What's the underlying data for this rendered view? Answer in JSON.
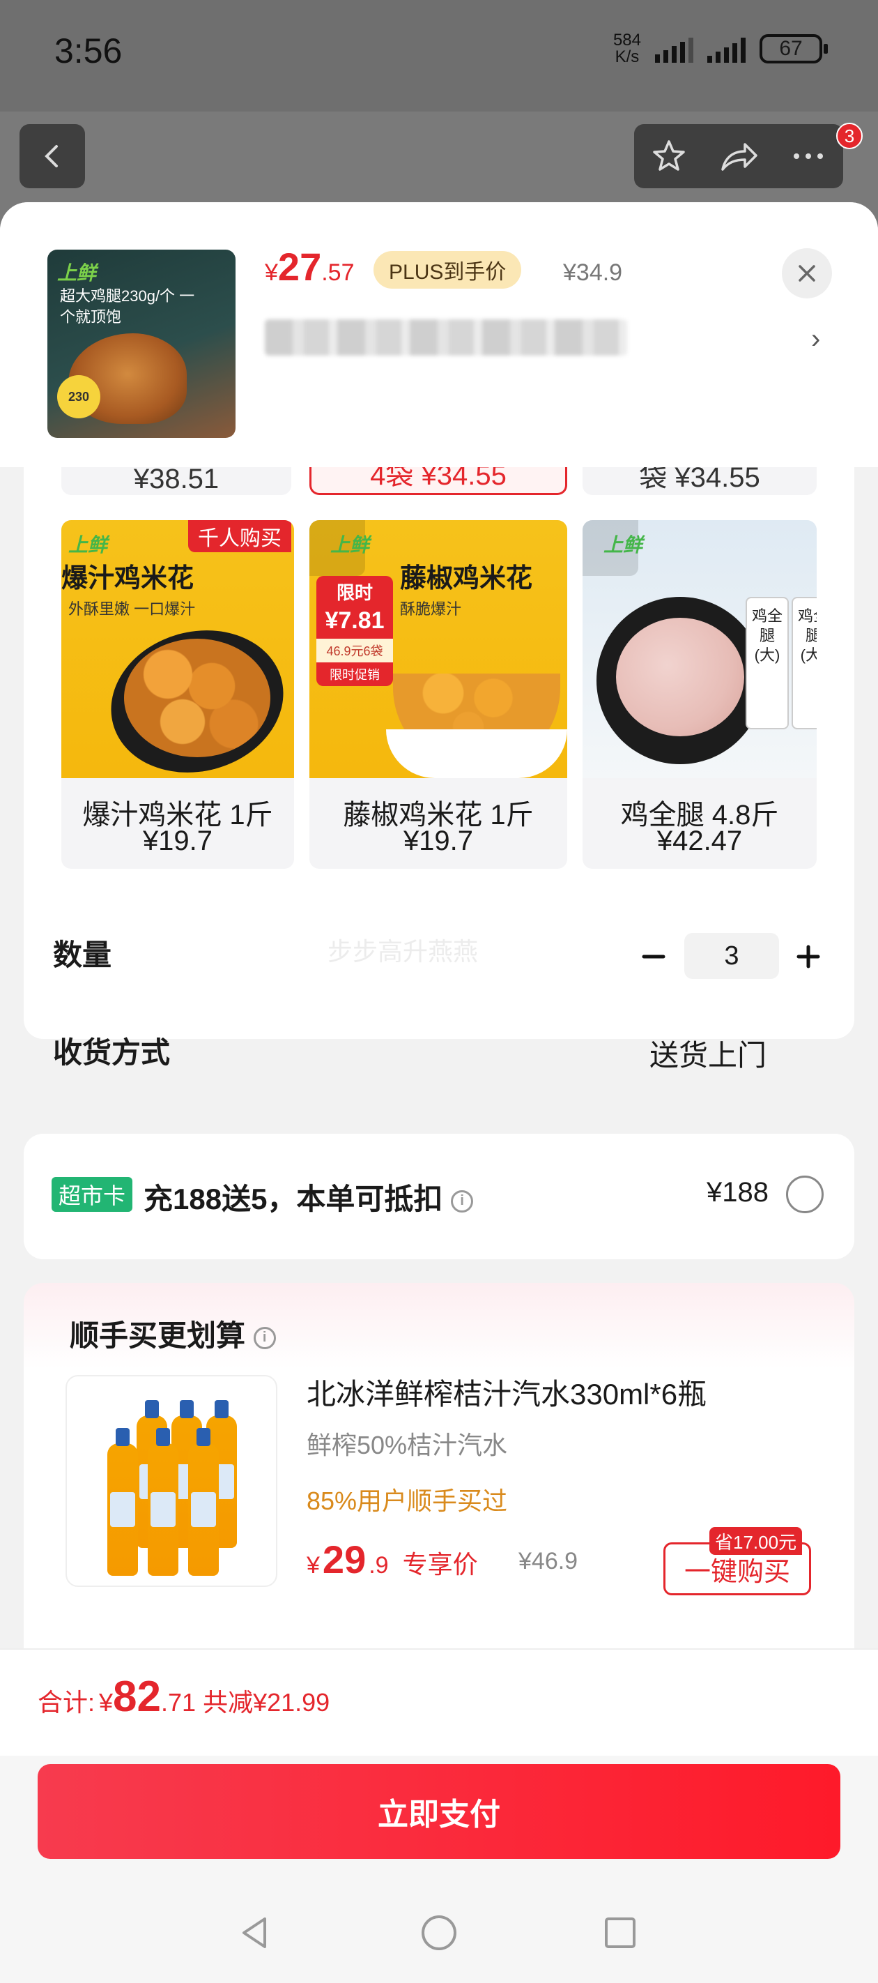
{
  "status_bar": {
    "time": "3:56",
    "net_speed_value": "584",
    "net_speed_unit": "K/s",
    "battery": "67"
  },
  "nav": {
    "cart_badge": "3",
    "icons": [
      "back-icon",
      "star-icon",
      "share-icon",
      "more-icon"
    ]
  },
  "product": {
    "price_currency": "¥",
    "price_int": "27",
    "price_dec": ".57",
    "plus_tag": "PLUS到手价",
    "orig_price": "¥34.9",
    "thumb_brand": "上鲜",
    "thumb_text": "超大鸡腿230g/个 一个就顶饱",
    "thumb_stamp": "230"
  },
  "peek_row": [
    {
      "text": "¥38.51",
      "selected": false
    },
    {
      "text": "4袋 ¥34.55",
      "selected": true
    },
    {
      "text": "袋 ¥34.55",
      "selected": false
    }
  ],
  "variants": [
    {
      "name": "爆汁鸡米花 1斤",
      "price": "¥19.7",
      "corner_tag": "千人购买",
      "img_title": "爆汁鸡米花",
      "img_sub": "外酥里嫩 一口爆汁",
      "brand": "上鲜"
    },
    {
      "name": "藤椒鸡米花 1斤",
      "price": "¥19.7",
      "img_title": "藤椒鸡米花",
      "img_sub": "酥脆爆汁",
      "brand": "上鲜",
      "promo": {
        "a": "限时",
        "b": "¥7.81",
        "c": "46.9元6袋",
        "d": "限时促销"
      }
    },
    {
      "name": "鸡全腿 4.8斤",
      "price": "¥42.47",
      "brand": "上鲜",
      "pack_text": "鸡全腿(大)"
    }
  ],
  "quantity": {
    "label": "数量",
    "watermark": "步步高升燕燕",
    "value": "3"
  },
  "delivery": {
    "label": "收货方式",
    "value": "送货上门"
  },
  "supermarket_card": {
    "tag": "超市卡",
    "text": "充188送5，本单可抵扣",
    "amount": "¥188"
  },
  "recommend": {
    "title": "顺手买更划算",
    "name": "北冰洋鲜榨桔汁汽水330ml*6瓶",
    "desc": "鲜榨50%桔汁汽水",
    "social": "85%用户顺手买过",
    "price_currency": "¥",
    "price_int": "29",
    "price_dec": ".9",
    "price_label": "专享价",
    "orig_price": "¥46.9",
    "save_tag": "省17.00元",
    "buy_label": "一键购买"
  },
  "footer": {
    "total_label": "合计:",
    "total_currency": "¥",
    "total_int": "82",
    "total_dec": ".71",
    "save_text": "共减¥21.99",
    "pay_label": "立即支付"
  },
  "colors": {
    "accent": "#e4262c",
    "plus_tag_bg": "#fbe7b5",
    "supermarket_tag": "#22b573",
    "social_proof": "#d98a1c"
  }
}
